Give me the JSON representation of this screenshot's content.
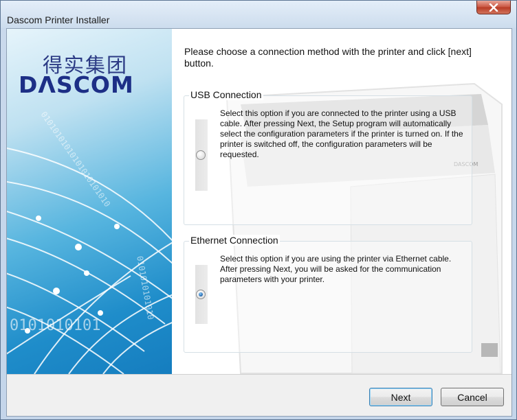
{
  "window": {
    "title": "Dascom Printer Installer"
  },
  "banner": {
    "chinese_name": "得实集团",
    "brand": "DΛSCOM",
    "binary_text_top": "01010101010101010101010",
    "binary_text_side": "0101010101010",
    "binary_text_bottom": "0101010101"
  },
  "printer_label": "DASCOM",
  "instruction": "Please choose a connection method with the printer and click [next] button.",
  "options": [
    {
      "label": "USB Connection",
      "description": "Select this option if you are connected to the printer using a USB cable. After pressing Next, the Setup program will automatically select the configuration parameters if the printer is turned on. If the printer is switched off, the configuration parameters will be requested.",
      "selected": false
    },
    {
      "label": "Ethernet Connection",
      "description": "Select this option if you are using the printer via Ethernet cable. After pressing Next, you will be asked for the communication parameters with your printer.",
      "selected": true
    }
  ],
  "buttons": {
    "next": "Next",
    "cancel": "Cancel"
  },
  "colors": {
    "accent": "#2b6cb0",
    "brand": "#1d2f86",
    "close_button": "#c9533f"
  },
  "icons": {
    "close": "close-icon"
  }
}
